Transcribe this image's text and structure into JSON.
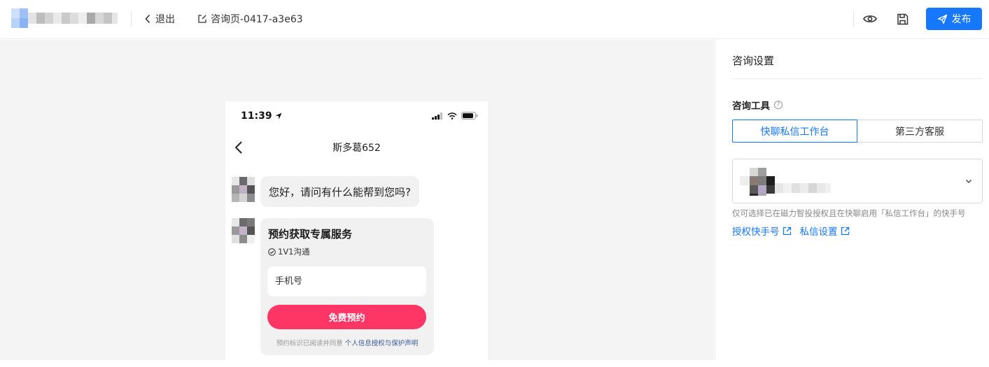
{
  "header": {
    "back_label": "退出",
    "page_name": "咨询页-0417-a3e63",
    "publish_label": "发布",
    "brand_color": "#1677ff"
  },
  "phone": {
    "status_time": "11:39",
    "chat_title": "斯多葛652",
    "greeting": "您好，请问有什么能帮到您吗?",
    "card": {
      "title": "预约获取专属服务",
      "check_label": "1V1沟通",
      "input_placeholder": "手机号",
      "button_label": "免费预约",
      "agree_prefix": "预约标识已阅读并同意",
      "agree_link": "个人信息授权与保护声明",
      "button_color": "#fe3666"
    }
  },
  "settings": {
    "title": "咨询设置",
    "tool_label": "咨询工具",
    "tools": [
      {
        "label": "快聊私信工作台",
        "active": true
      },
      {
        "label": "第三方客服",
        "active": false
      }
    ],
    "hint": "仅可选择已在磁力智投授权且在快聊启用「私信工作台」的快手号",
    "links": [
      {
        "label": "授权快手号"
      },
      {
        "label": "私信设置"
      }
    ]
  }
}
